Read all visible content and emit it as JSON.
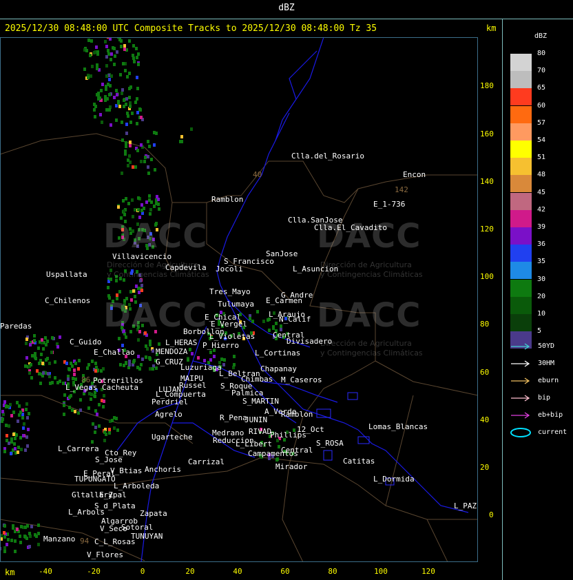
{
  "header": {
    "units_title": "dBZ",
    "composite_line": "2025/12/30 08:48:00 UTC Composite Tracks to 2025/12/30 08:48:00 Tz 35",
    "km_top": "km",
    "km_bottom": "km"
  },
  "axes": {
    "y_ticks": [
      "180",
      "160",
      "140",
      "120",
      "100",
      "80",
      "60",
      "40",
      "20",
      "0"
    ],
    "x_ticks": [
      "-40",
      "-20",
      "0",
      "20",
      "40",
      "60",
      "80",
      "100",
      "120"
    ]
  },
  "legend": {
    "title": "dBZ",
    "levels": [
      {
        "value": "80",
        "color": "#d3d3d3"
      },
      {
        "value": "70",
        "color": "#bdbdbd"
      },
      {
        "value": "65",
        "color": "#ff3b1f"
      },
      {
        "value": "60",
        "color": "#ff6a10"
      },
      {
        "value": "57",
        "color": "#ff9a60"
      },
      {
        "value": "54",
        "color": "#ffff00"
      },
      {
        "value": "51",
        "color": "#f6c030"
      },
      {
        "value": "48",
        "color": "#d9893a"
      },
      {
        "value": "45",
        "color": "#c06880"
      },
      {
        "value": "42",
        "color": "#d01a8a"
      },
      {
        "value": "39",
        "color": "#7a10c8"
      },
      {
        "value": "36",
        "color": "#2040f0"
      },
      {
        "value": "35",
        "color": "#1e8ae6"
      },
      {
        "value": "30",
        "color": "#0e7a10"
      },
      {
        "value": "20",
        "color": "#0a5a0a"
      },
      {
        "value": "10",
        "color": "#0a3f0a"
      },
      {
        "value": "5",
        "color": "#4a3a8a"
      }
    ],
    "tracks": [
      {
        "label": "50YD",
        "color": "#40d0d0"
      },
      {
        "label": "30HM",
        "color": "#ffffff"
      },
      {
        "label": "eburn",
        "color": "#f0c060"
      },
      {
        "label": "bip",
        "color": "#ffc0d0"
      },
      {
        "label": "eb+bip",
        "color": "#e040e0"
      },
      {
        "label": "current",
        "color": "#00e0ff"
      }
    ]
  },
  "watermark": {
    "brand": "DACC",
    "line1": "Dirección de Agricultura",
    "line2": "y Contingencias Climáticas"
  },
  "places": [
    {
      "name": "Clla.del_Rosario"
    },
    {
      "name": "Encon"
    },
    {
      "name": "142"
    },
    {
      "name": "E_1-736"
    },
    {
      "name": "Ramblon"
    },
    {
      "name": "Clla.SanJose"
    },
    {
      "name": "Clla.El_Cavadito"
    },
    {
      "name": "Villavicencio"
    },
    {
      "name": "S_Francisco"
    },
    {
      "name": "SanJose"
    },
    {
      "name": "Capdevila"
    },
    {
      "name": "Jocoli"
    },
    {
      "name": "L_Asuncion"
    },
    {
      "name": "Uspallata"
    },
    {
      "name": "Tres_Mayo"
    },
    {
      "name": "G_Andre"
    },
    {
      "name": "C_Chilenos"
    },
    {
      "name": "Tulumaya"
    },
    {
      "name": "E_Carmen"
    },
    {
      "name": "E_Chical"
    },
    {
      "name": "L_Araujo"
    },
    {
      "name": "N_Calif"
    },
    {
      "name": "E_Vergel"
    },
    {
      "name": "Paredas"
    },
    {
      "name": "Borbollon"
    },
    {
      "name": "L_Violetas"
    },
    {
      "name": "Central"
    },
    {
      "name": "C_Guido"
    },
    {
      "name": "L_HERAS"
    },
    {
      "name": "P_Hierro"
    },
    {
      "name": "Divisadero"
    },
    {
      "name": "E_Challao"
    },
    {
      "name": "MENDOZA"
    },
    {
      "name": "L_Cortinas"
    },
    {
      "name": "G_CRUZ"
    },
    {
      "name": "Luzuriaga"
    },
    {
      "name": "Chapanay"
    },
    {
      "name": "L_Beltran"
    },
    {
      "name": "Potrerillos"
    },
    {
      "name": "MAIPU"
    },
    {
      "name": "Chimbas"
    },
    {
      "name": "M_Caseros"
    },
    {
      "name": "L_Vegas"
    },
    {
      "name": "Cacheuta"
    },
    {
      "name": "Russel"
    },
    {
      "name": "S_Roque"
    },
    {
      "name": "LUJAN"
    },
    {
      "name": "Palmica"
    },
    {
      "name": "L_Compuerta"
    },
    {
      "name": "S_MARTIN"
    },
    {
      "name": "Perdriel"
    },
    {
      "name": "A_Verde"
    },
    {
      "name": "Ramblon"
    },
    {
      "name": "Agrelo"
    },
    {
      "name": "R_Pena"
    },
    {
      "name": "JUNIN"
    },
    {
      "name": "12_Oct"
    },
    {
      "name": "Lomas_Blancas"
    },
    {
      "name": "Medrano"
    },
    {
      "name": "RIVAD"
    },
    {
      "name": "Phillips"
    },
    {
      "name": "L_Carrera"
    },
    {
      "name": "Ugarteche"
    },
    {
      "name": "Reduccion"
    },
    {
      "name": "S_ROSA"
    },
    {
      "name": "Cto_Rey"
    },
    {
      "name": "L_Libert"
    },
    {
      "name": "S_Jose"
    },
    {
      "name": "Campamentos"
    },
    {
      "name": "Central"
    },
    {
      "name": "Catitas"
    },
    {
      "name": "Carrizal"
    },
    {
      "name": "E_Peral"
    },
    {
      "name": "V_Btias"
    },
    {
      "name": "Anchoris"
    },
    {
      "name": "Mirador"
    },
    {
      "name": "TUPUNGATO"
    },
    {
      "name": "L_Dormida"
    },
    {
      "name": "L_Arboleda"
    },
    {
      "name": "Gltallary"
    },
    {
      "name": "E_Zpal"
    },
    {
      "name": "S_d_Plata"
    },
    {
      "name": "L_PAZ"
    },
    {
      "name": "L_Arbols"
    },
    {
      "name": "Zapata"
    },
    {
      "name": "Algarrob"
    },
    {
      "name": "Sotoral"
    },
    {
      "name": "V_Seco"
    },
    {
      "name": "TUNUYAN"
    },
    {
      "name": "Manzano"
    },
    {
      "name": "C_L_Rosas"
    },
    {
      "name": "V_Flores"
    },
    {
      "name": "40"
    },
    {
      "name": "94"
    },
    {
      "name": "86"
    }
  ]
}
